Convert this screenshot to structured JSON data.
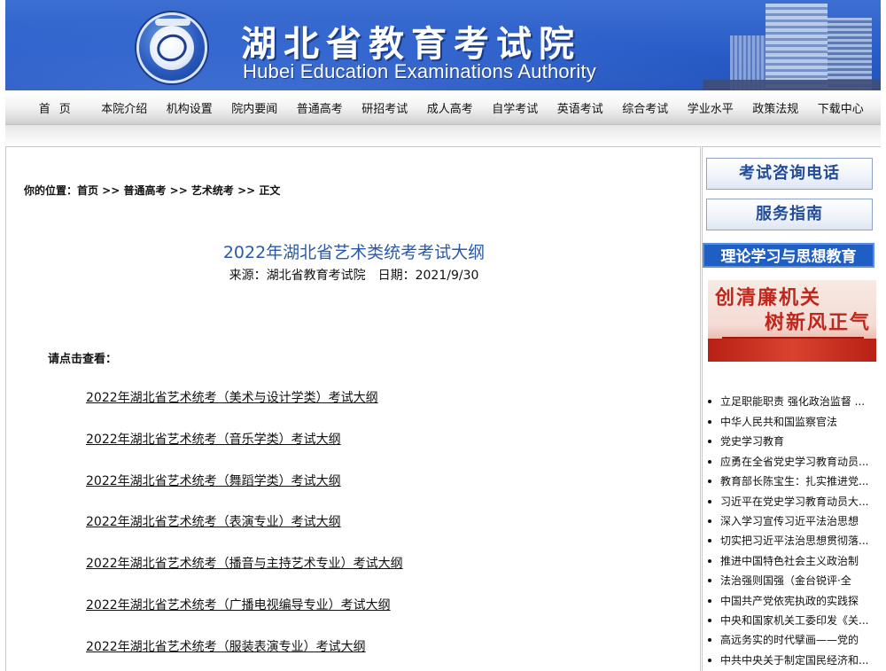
{
  "header": {
    "title_cn": "湖北省教育考试院",
    "title_en": "Hubei Education Examinations Authority"
  },
  "nav": {
    "items": [
      "首页",
      "本院介绍",
      "机构设置",
      "院内要闻",
      "普通高考",
      "研招考试",
      "成人高考",
      "自学考试",
      "英语考试",
      "综合考试",
      "学业水平",
      "政策法规",
      "下载中心"
    ]
  },
  "breadcrumb": "你的位置：首页 >> 普通高考 >> 艺术统考 >> 正文",
  "article": {
    "title": "2022年湖北省艺术类统考考试大纲",
    "source": "来源：湖北省教育考试院",
    "date": "日期：2021/9/30",
    "intro": "请点击查看：",
    "links": [
      "2022年湖北省艺术统考（美术与设计学类）考试大纲",
      "2022年湖北省艺术统考（音乐学类）考试大纲",
      "2022年湖北省艺术统考（舞蹈学类）考试大纲",
      "2022年湖北省艺术统考（表演专业）考试大纲",
      "2022年湖北省艺术统考（播音与主持艺术专业）考试大纲",
      "2022年湖北省艺术统考（广播电视编导专业）考试大纲",
      "2022年湖北省艺术统考（服装表演专业）考试大纲"
    ]
  },
  "sidebar": {
    "button1": "考试咨询电话",
    "button2": "服务指南",
    "section_title": "理论学习与思想教育",
    "promo_line1": "创清廉机关",
    "promo_line2": "树新风正气",
    "news": [
      "立足职能职责 强化政治监督 ...",
      "中华人民共和国监察官法",
      "党史学习教育",
      "应勇在全省党史学习教育动员...",
      "教育部长陈宝生：扎实推进党...",
      "习近平在党史学习教育动员大...",
      "深入学习宣传习近平法治思想",
      "切实把习近平法治思想贯彻落...",
      "推进中国特色社会主义政治制",
      "法治强则国强（金台锐评·全",
      "中国共产党依宪执政的实践探",
      "中央和国家机关工委印发《关...",
      "高远务实的时代擘画——党的",
      "中共中央关于制定国民经济和..."
    ]
  },
  "colors": {
    "banner_blue": "#2a5dc8",
    "title_blue": "#2b5aa8",
    "section_blue": "#1f5fc4",
    "promo_red": "#c0261b"
  }
}
